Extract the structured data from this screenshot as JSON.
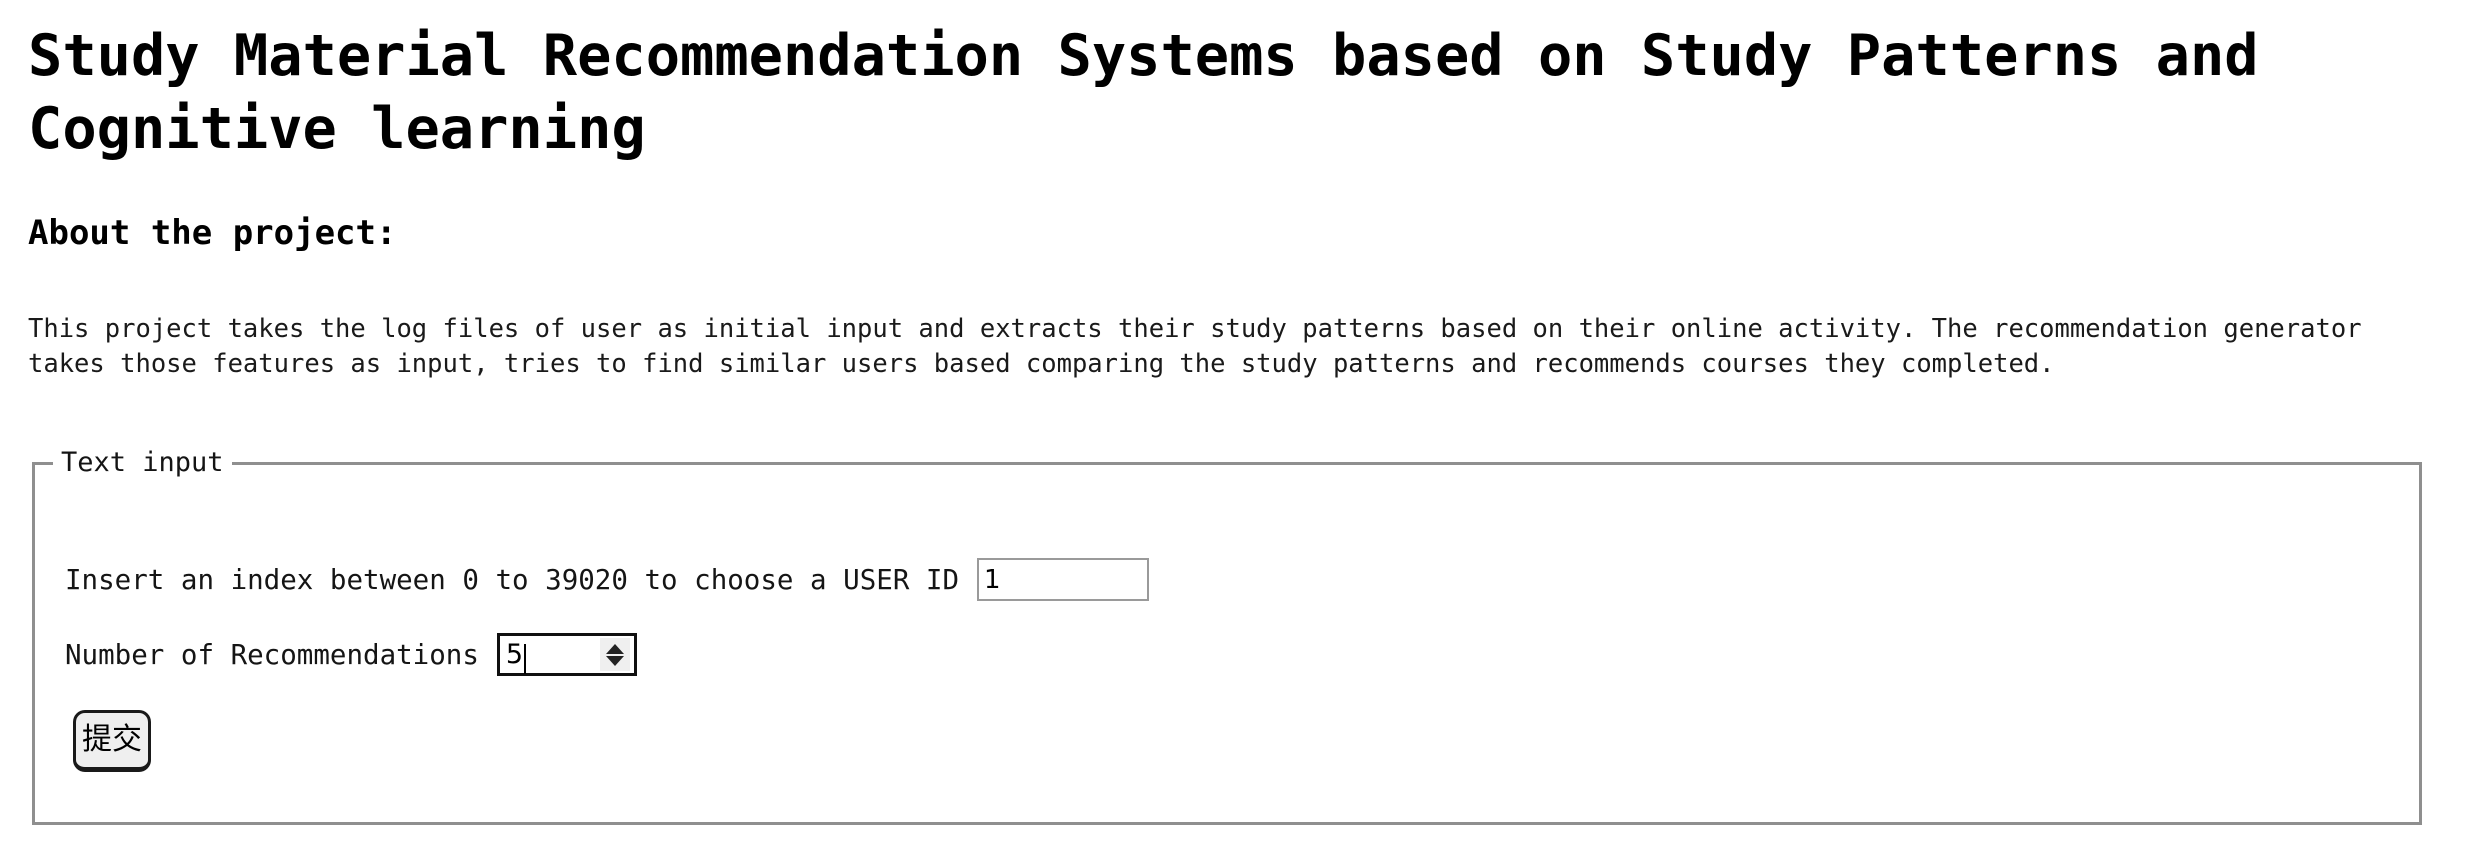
{
  "page": {
    "title": "Study Material Recommendation Systems based on Study Patterns and Cognitive learning",
    "section_heading": "About the project:",
    "about_paragraph": "This project takes the log files of user as initial input and extracts their study patterns based on their online activity. The recommendation generator takes those features as input, tries to find similar users based comparing the study patterns and recommends courses they completed."
  },
  "form": {
    "legend": "Text input",
    "fields": [
      {
        "label": "Insert an index between 0 to 39020 to choose a USER ID",
        "value": "1",
        "placeholder": "",
        "type": "text"
      },
      {
        "label": "Number of Recommendations",
        "value": "5",
        "placeholder": "",
        "type": "number",
        "spinner_up_icon": "triangle-up-icon",
        "spinner_down_icon": "triangle-down-icon"
      }
    ],
    "submit_label": "提交"
  },
  "colors": {
    "page_background": "#ffffff",
    "text": "#000000",
    "fieldset_border": "#8f8f8f",
    "input_border": "#9a9a9a",
    "focused_input_border": "#101010",
    "button_background": "#efefef",
    "button_border": "#1a1a1a",
    "spinner_background": "#efefef"
  }
}
